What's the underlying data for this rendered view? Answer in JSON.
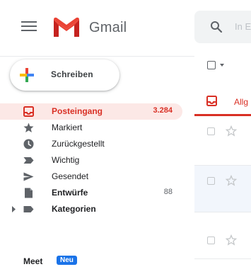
{
  "header": {
    "app_name": "Gmail",
    "search_placeholder": "In E"
  },
  "compose": {
    "label": "Schreiben"
  },
  "sidebar": {
    "items": [
      {
        "label": "Posteingang",
        "count": "3.284",
        "icon": "inbox-icon"
      },
      {
        "label": "Markiert",
        "count": "",
        "icon": "star-icon"
      },
      {
        "label": "Zurückgestellt",
        "count": "",
        "icon": "clock-icon"
      },
      {
        "label": "Wichtig",
        "count": "",
        "icon": "label-important-icon"
      },
      {
        "label": "Gesendet",
        "count": "",
        "icon": "send-icon"
      },
      {
        "label": "Entwürfe",
        "count": "88",
        "icon": "draft-icon"
      },
      {
        "label": "Kategorien",
        "count": "",
        "icon": "label-icon"
      }
    ]
  },
  "meet": {
    "label": "Meet",
    "badge": "Neu"
  },
  "list": {
    "primary_tab_label": "Allg"
  },
  "colors": {
    "accent_red": "#d93025",
    "active_bg": "#fce8e6",
    "badge_blue": "#1a73e8",
    "icon_grey": "#5f6368"
  }
}
